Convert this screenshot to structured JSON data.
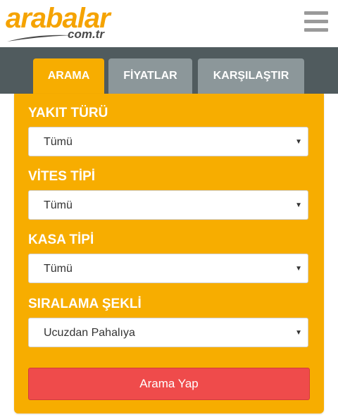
{
  "header": {
    "logo_main": "arabalar",
    "logo_sub": "com.tr",
    "menu_icon": "hamburger-menu-icon"
  },
  "tabs": [
    {
      "label": "ARAMA",
      "active": true
    },
    {
      "label": "FİYATLAR",
      "active": false
    },
    {
      "label": "KARŞILAŞTIR",
      "active": false
    }
  ],
  "form": {
    "fields": [
      {
        "label": "YAKIT TÜRÜ",
        "value": "Tümü"
      },
      {
        "label": "VİTES TİPİ",
        "value": "Tümü"
      },
      {
        "label": "KASA TİPİ",
        "value": "Tümü"
      },
      {
        "label": "SIRALAMA ŞEKLİ",
        "value": "Ucuzdan Pahalıya"
      }
    ],
    "dropdown_arrow": "▼",
    "submit_label": "Arama Yap"
  },
  "colors": {
    "brand_orange": "#f7ad00",
    "tab_bar": "#505b5e",
    "tab_inactive": "#8c979a",
    "submit_red": "#ef4b4b"
  }
}
